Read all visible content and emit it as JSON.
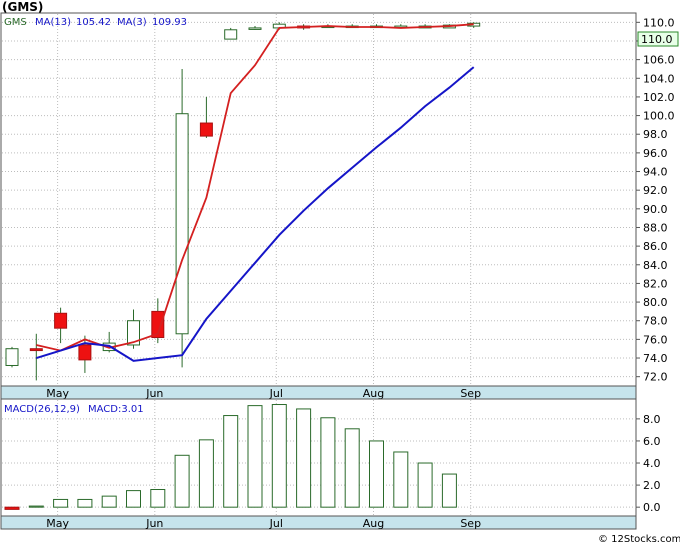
{
  "title": "(GMS)",
  "watermark": "© 12Stocks.com",
  "colors": {
    "up_body": "#ffffff",
    "up_stroke": "#2a6a2a",
    "down_body": "#ee1111",
    "ma13": "#1515c8",
    "ma3": "#d42020",
    "macd_bar": "#2a6a2a",
    "panel_band": "#c6e4ec",
    "grid": "#bdbdbd",
    "last_badge_bg": "#e8ffe8",
    "last_badge_border": "#2a8a2a"
  },
  "chart_data": [
    {
      "type": "candlestick",
      "legend": {
        "symbol": "GMS",
        "ma13_label": "MA(13)",
        "ma13_value": "105.42",
        "ma3_label": "MA(3)",
        "ma3_value": "109.93"
      },
      "last_value_label": "110.0",
      "x_labels": [
        {
          "label": "May",
          "index": 2
        },
        {
          "label": "Jun",
          "index": 6
        },
        {
          "label": "Jul",
          "index": 11
        },
        {
          "label": "Aug",
          "index": 15
        },
        {
          "label": "Sep",
          "index": 19
        }
      ],
      "y_ticks": [
        72,
        74,
        76,
        78,
        80,
        82,
        84,
        86,
        88,
        90,
        92,
        94,
        96,
        98,
        100,
        102,
        104,
        106,
        108,
        110
      ],
      "ylim": [
        71.0,
        111.0
      ],
      "candles": [
        {
          "o": 73.2,
          "h": 75.2,
          "l": 73.0,
          "c": 75.0
        },
        {
          "o": 75.0,
          "h": 76.6,
          "l": 71.6,
          "c": 74.8
        },
        {
          "o": 78.8,
          "h": 79.4,
          "l": 75.6,
          "c": 77.2
        },
        {
          "o": 75.4,
          "h": 76.4,
          "l": 72.4,
          "c": 73.8
        },
        {
          "o": 74.8,
          "h": 76.8,
          "l": 74.6,
          "c": 75.6
        },
        {
          "o": 75.4,
          "h": 79.2,
          "l": 75.0,
          "c": 78.0
        },
        {
          "o": 79.0,
          "h": 80.4,
          "l": 75.6,
          "c": 76.2
        },
        {
          "o": 76.6,
          "h": 105.0,
          "l": 73.0,
          "c": 100.2
        },
        {
          "o": 99.2,
          "h": 102.0,
          "l": 97.6,
          "c": 97.8
        },
        {
          "o": 108.2,
          "h": 109.4,
          "l": 108.2,
          "c": 109.2
        },
        {
          "o": 109.4,
          "h": 109.6,
          "l": 109.2,
          "c": 109.4
        },
        {
          "o": 109.4,
          "h": 110.0,
          "l": 109.2,
          "c": 109.8
        },
        {
          "o": 109.6,
          "h": 109.8,
          "l": 109.2,
          "c": 109.4
        },
        {
          "o": 109.6,
          "h": 109.8,
          "l": 109.4,
          "c": 109.6
        },
        {
          "o": 109.6,
          "h": 109.8,
          "l": 109.4,
          "c": 109.6
        },
        {
          "o": 109.6,
          "h": 109.8,
          "l": 109.4,
          "c": 109.6
        },
        {
          "o": 109.6,
          "h": 109.8,
          "l": 109.4,
          "c": 109.6
        },
        {
          "o": 109.4,
          "h": 109.8,
          "l": 109.4,
          "c": 109.6
        },
        {
          "o": 109.4,
          "h": 109.8,
          "l": 109.4,
          "c": 109.7
        },
        {
          "o": 109.6,
          "h": 110.0,
          "l": 109.4,
          "c": 109.9
        }
      ],
      "ma13": [
        74.0,
        74.8,
        75.6,
        75.3,
        73.7,
        74.0,
        74.3,
        78.2,
        81.2,
        84.2,
        87.2,
        89.8,
        92.2,
        94.4,
        96.6,
        98.7,
        101.0,
        103.0,
        105.2
      ],
      "ma13_start_index": 1,
      "ma3": [
        75.4,
        74.8,
        76.0,
        75.1,
        75.7,
        76.6,
        84.5,
        91.2,
        102.4,
        105.4,
        109.4,
        109.5,
        109.6,
        109.5,
        109.5,
        109.4,
        109.5,
        109.6,
        109.8
      ],
      "ma3_start_index": 1
    },
    {
      "type": "bar",
      "title": "MACD(26,12,9)",
      "macd_label": "MACD:3.01",
      "y_ticks": [
        0.0,
        2.0,
        4.0,
        6.0,
        8.0
      ],
      "y_tick_labels": [
        "0.0",
        "2.0",
        "4.0",
        "6.0",
        "8.0"
      ],
      "ylim": [
        -0.8,
        9.8
      ],
      "values": [
        -0.2,
        0.1,
        0.7,
        0.7,
        1.0,
        1.5,
        1.6,
        4.7,
        6.1,
        8.3,
        9.2,
        9.3,
        8.9,
        8.1,
        7.1,
        6.0,
        5.0,
        4.0,
        3.0
      ]
    }
  ]
}
